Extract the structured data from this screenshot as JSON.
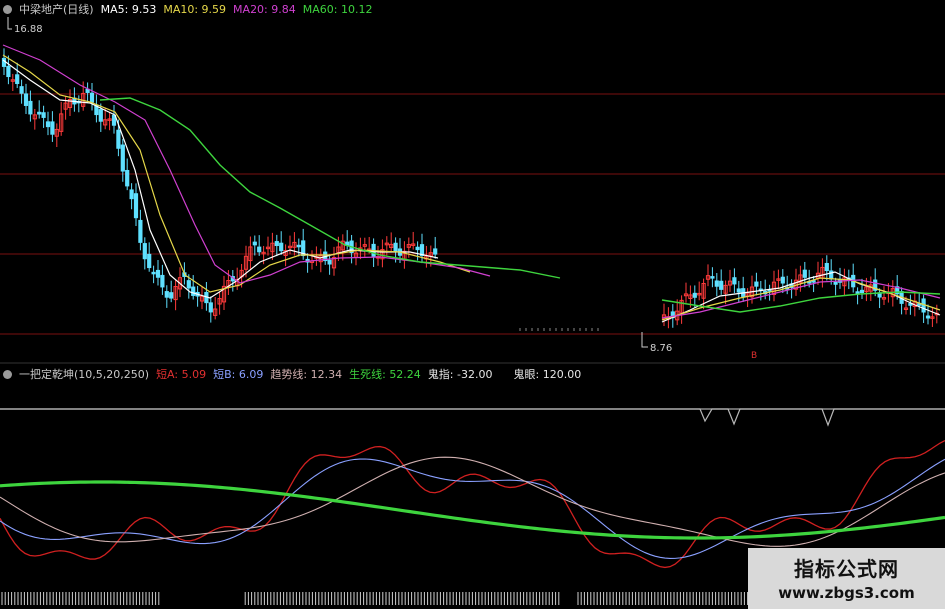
{
  "stock_header": {
    "title": "中梁地产(日线)",
    "ma5_label": "MA5:",
    "ma5_value": "9.53",
    "ma10_label": "MA10:",
    "ma10_value": "9.59",
    "ma20_label": "MA20:",
    "ma20_value": "9.84",
    "ma60_label": "MA60:",
    "ma60_value": "10.12"
  },
  "indicator_header": {
    "title": "一把定乾坤(10,5,20,250)",
    "a_label": "短A:",
    "a_value": "5.09",
    "b_label": "短B:",
    "b_value": "6.09",
    "trend_label": "趋势线:",
    "trend_value": "12.34",
    "life_label": "生死线:",
    "life_value": "52.24",
    "ghost_label": "鬼指:",
    "ghost_value": "-32.00",
    "eye_label": "鬼眼:",
    "eye_value": "120.00"
  },
  "price_high_label": "16.88",
  "price_low_label": "8.76",
  "marker_label": "B",
  "watermark": {
    "title": "指标公式网",
    "url": "www.zbgs3.com"
  },
  "colors": {
    "up": "#ff3b3b",
    "down": "#5fe0ff",
    "ma5": "#ffffff",
    "ma10": "#e6d84a",
    "ma20": "#d040d0",
    "ma60": "#3ed43e",
    "grid": "#7a1010",
    "ind_a": "#d02020",
    "ind_b": "#8aa0ff",
    "ind_c": "#d0b0b0",
    "ind_green": "#3ed43e"
  },
  "chart_data": [
    {
      "type": "candlestick",
      "title": "中梁地产(日线)",
      "ylim": [
        8.76,
        16.88
      ],
      "series": [
        {
          "name": "MA5",
          "value": 9.53
        },
        {
          "name": "MA10",
          "value": 9.59
        },
        {
          "name": "MA20",
          "value": 9.84
        },
        {
          "name": "MA60",
          "value": 10.12
        }
      ],
      "annotations": [
        {
          "text": "16.88",
          "kind": "high"
        },
        {
          "text": "8.76",
          "kind": "low"
        }
      ]
    },
    {
      "type": "line",
      "title": "一把定乾坤(10,5,20,250)",
      "series": [
        {
          "name": "短A",
          "value": 5.09
        },
        {
          "name": "短B",
          "value": 6.09
        },
        {
          "name": "趋势线",
          "value": 12.34
        },
        {
          "name": "生死线",
          "value": 52.24
        },
        {
          "name": "鬼指",
          "value": -32.0
        },
        {
          "name": "鬼眼",
          "value": 120.0
        }
      ]
    }
  ]
}
